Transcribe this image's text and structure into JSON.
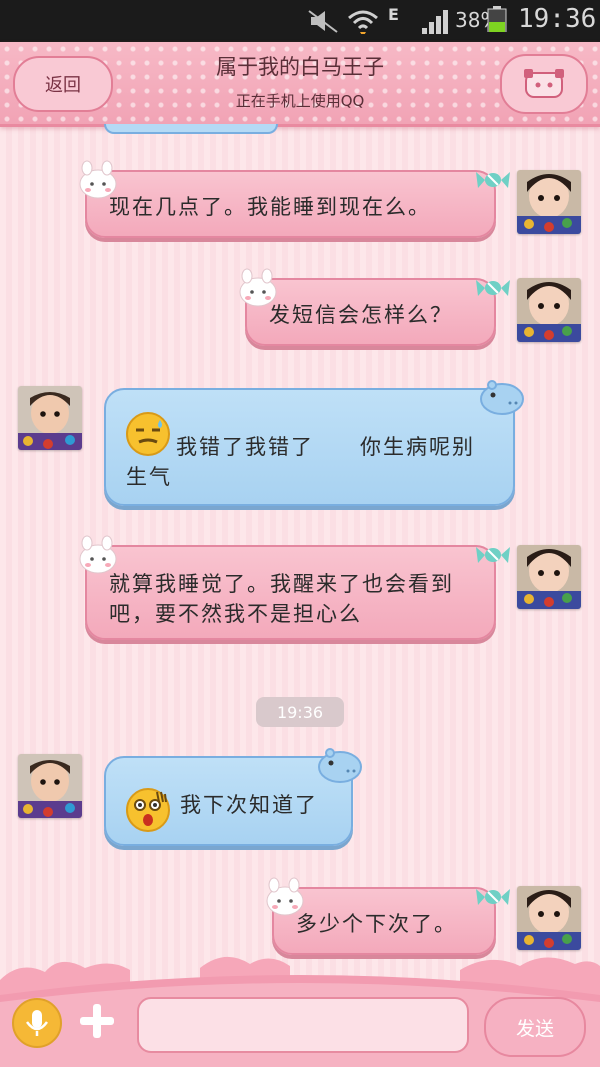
{
  "status_bar": {
    "network_type": "E",
    "battery": "38%",
    "time": "19:36"
  },
  "header": {
    "back_label": "返回",
    "title": "属于我的白马王子",
    "subtitle": "正在手机上使用QQ",
    "menu_icon": "qq-penguin-face-icon"
  },
  "colors": {
    "pink_bubble": "#f6b3c3",
    "blue_bubble": "#b5daf5",
    "header": "#f3a9bb",
    "background": "#fde7ea"
  },
  "messages": [
    {
      "side": "right",
      "text": "现在几点了。我能睡到现在么。"
    },
    {
      "side": "right",
      "text": "发短信会怎样么？"
    },
    {
      "side": "left",
      "emoji": "sweat-emoji-icon",
      "text": "我错了我错了　　你生病呢别生气"
    },
    {
      "side": "right",
      "text": "就算我睡觉了。我醒来了也会看到吧，要不然我不是担心么"
    },
    {
      "side": "left",
      "emoji": "shocked-emoji-icon",
      "text": "我下次知道了"
    },
    {
      "side": "right",
      "text": "多少个下次了。"
    }
  ],
  "timestamp": "19:36",
  "input": {
    "placeholder": "",
    "value": "",
    "send_label": "发送"
  }
}
